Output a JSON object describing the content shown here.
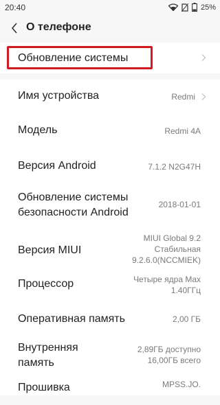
{
  "status_bar": {
    "time": "20:40",
    "battery": "25%"
  },
  "header": {
    "title": "О телефоне"
  },
  "system_update": {
    "label": "Обновление системы"
  },
  "items": [
    {
      "label": "Имя устройства",
      "value": "Redmi"
    },
    {
      "label": "Модель",
      "value": "Redmi 4A"
    },
    {
      "label": "Версия Android",
      "value": "7.1.2 N2G47H"
    },
    {
      "label": [
        "Обновление системы",
        "безопасности Android"
      ],
      "value": "2018-01-01"
    },
    {
      "label": "Версия MIUI",
      "value": [
        "MIUI Global 9.2",
        "Стабильная",
        "9.2.6.0(NCCMIEK)"
      ]
    },
    {
      "label": "Процессор",
      "value": [
        "Четыре ядра Max",
        "1.40ГГц"
      ]
    },
    {
      "label": "Оперативная память",
      "value": "2,00 ГБ"
    },
    {
      "label": [
        "Внутренняя",
        "память"
      ],
      "value": [
        "2,89ГБ доступно",
        "16,00ГБ всего"
      ]
    },
    {
      "label": "Прошивка",
      "value": "MPSS.JO."
    }
  ]
}
